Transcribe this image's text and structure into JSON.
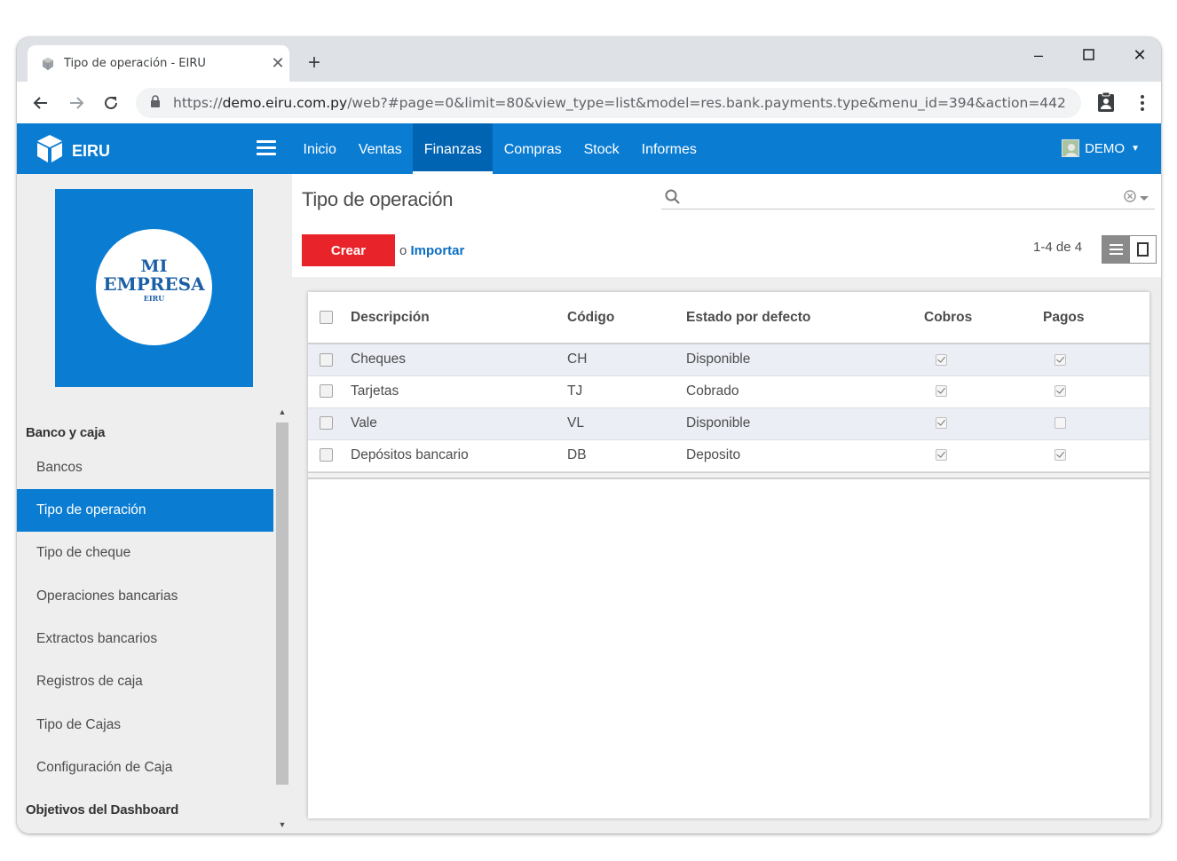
{
  "browser": {
    "tab_title": "Tipo de operación - EIRU",
    "url_scheme": "https://",
    "url_host": "demo.eiru.com.py",
    "url_path": "/web?#page=0&limit=80&view_type=list&model=res.bank.payments.type&menu_id=394&action=442"
  },
  "app": {
    "brand": "EIRU",
    "menu": [
      "Inicio",
      "Ventas",
      "Finanzas",
      "Compras",
      "Stock",
      "Informes"
    ],
    "active_menu": "Finanzas",
    "user": "DEMO"
  },
  "logo": {
    "line1": "MI",
    "line2": "EMPRESA",
    "line3": "EIRU"
  },
  "sidebar": {
    "section1": "Banco y caja",
    "items": [
      "Bancos",
      "Tipo de operación",
      "Tipo de cheque",
      "Operaciones bancarias",
      "Extractos bancarios",
      "Registros de caja",
      "Tipo de Cajas",
      "Configuración de Caja"
    ],
    "active_item": "Tipo de operación",
    "section2": "Objetivos del Dashboard"
  },
  "page": {
    "title": "Tipo de operación",
    "search_placeholder": "",
    "create_label": "Crear",
    "or_label": "o",
    "import_label": "Importar",
    "pager": "1-4 de 4"
  },
  "table": {
    "headers": [
      "Descripción",
      "Código",
      "Estado por defecto",
      "Cobros",
      "Pagos"
    ],
    "rows": [
      {
        "descripcion": "Cheques",
        "codigo": "CH",
        "estado": "Disponible",
        "cobros": true,
        "pagos": true
      },
      {
        "descripcion": "Tarjetas",
        "codigo": "TJ",
        "estado": "Cobrado",
        "cobros": true,
        "pagos": true
      },
      {
        "descripcion": "Vale",
        "codigo": "VL",
        "estado": "Disponible",
        "cobros": true,
        "pagos": false
      },
      {
        "descripcion": "Depósitos bancario",
        "codigo": "DB",
        "estado": "Deposito",
        "cobros": true,
        "pagos": true
      }
    ]
  },
  "colors": {
    "primary": "#0a7dd3",
    "create_button": "#e8242a",
    "link": "#0a6ec4"
  }
}
